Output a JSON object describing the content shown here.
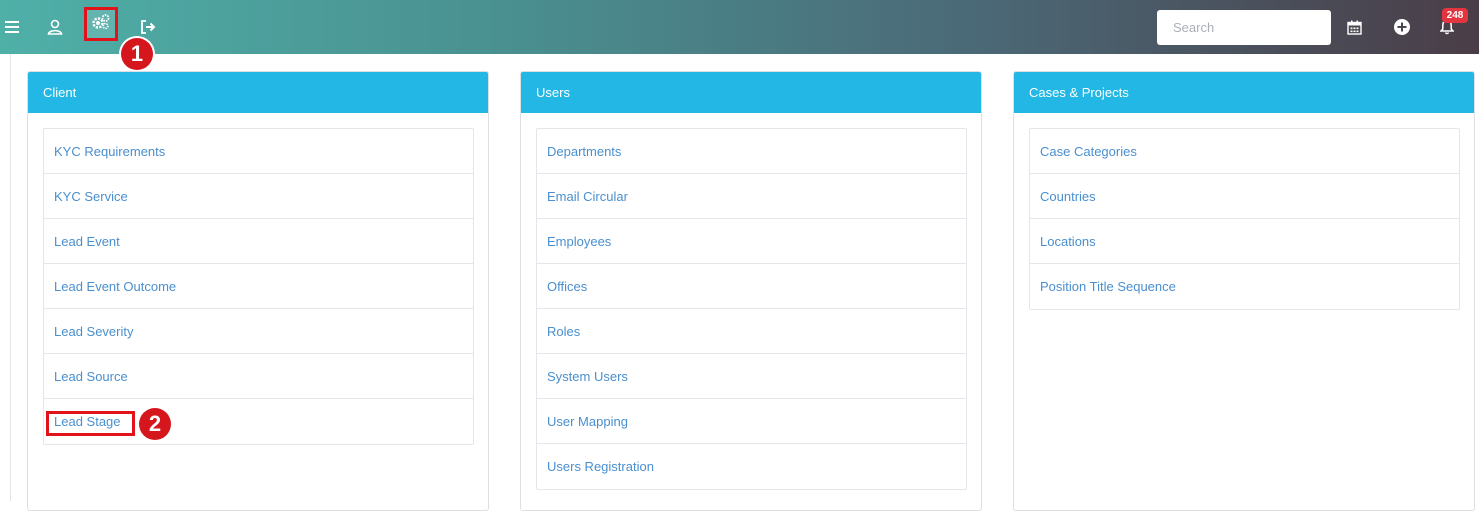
{
  "topbar": {
    "search_placeholder": "Search",
    "notification_count": "248",
    "icons": [
      "menu-icon",
      "user-icon",
      "gear-icon",
      "logout-icon",
      "calendar-icon",
      "plus-icon",
      "bell-icon"
    ]
  },
  "callouts": [
    "1",
    "2"
  ],
  "panels": [
    {
      "title": "Client",
      "items": [
        "KYC Requirements",
        "KYC Service",
        "Lead Event",
        "Lead Event Outcome",
        "Lead Severity",
        "Lead Source",
        "Lead Stage"
      ]
    },
    {
      "title": "Users",
      "items": [
        "Departments",
        "Email Circular",
        "Employees",
        "Offices",
        "Roles",
        "System Users",
        "User Mapping",
        "Users Registration"
      ]
    },
    {
      "title": "Cases & Projects",
      "items": [
        "Case Categories",
        "Countries",
        "Locations",
        "Position Title Sequence"
      ]
    }
  ],
  "colors": {
    "header_panel": "#23b7e5",
    "link": "#4a8fce",
    "highlight": "#e2121b",
    "badge": "#e3353f"
  }
}
